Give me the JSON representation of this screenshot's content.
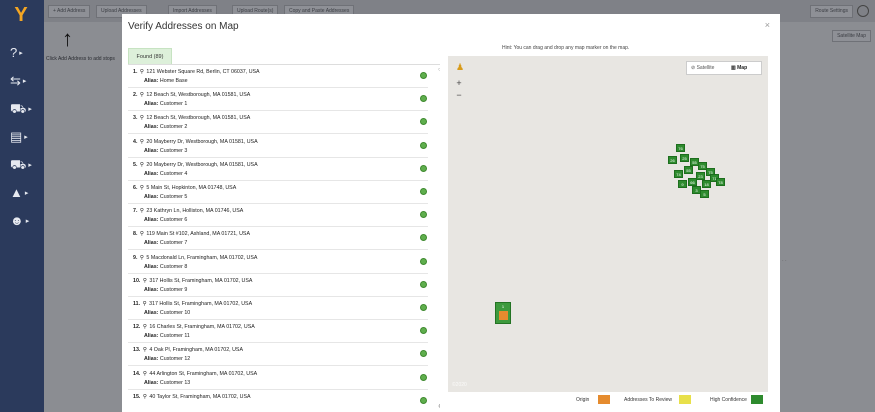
{
  "leftnav": {
    "logo": "Y",
    "items": [
      {
        "icon": "help-circle-icon",
        "glyph": "?"
      },
      {
        "icon": "route-icon",
        "glyph": "⇆"
      },
      {
        "icon": "cart-icon",
        "glyph": "⛟"
      },
      {
        "icon": "orders-icon",
        "glyph": "▤"
      },
      {
        "icon": "truck-icon",
        "glyph": "⛟"
      },
      {
        "icon": "analytics-icon",
        "glyph": "▲"
      },
      {
        "icon": "team-icon",
        "glyph": "☻"
      }
    ]
  },
  "topbar": {
    "buttons": [
      "+ Add Address",
      "Upload Addresses",
      "Import Addresses",
      "Upload Route(s)",
      "Copy and Paste Addresses"
    ],
    "route_settings": "Route Settings"
  },
  "background": {
    "hint": "Click Add Address to add stops",
    "sat_map": "Satellite  Map"
  },
  "modal": {
    "title": "Verify Addresses on Map",
    "close": "×",
    "found_tab": "Found (89)",
    "map_hint": "Hint: You can drag and drop any map marker on the map.",
    "addresses": [
      {
        "num": "1.",
        "address": "121 Webster Square Rd, Berlin, CT 06037, USA",
        "alias_label": "Alias:",
        "alias": "Home Base"
      },
      {
        "num": "2.",
        "address": "12 Beach St, Westborough, MA 01581, USA",
        "alias_label": "Alias:",
        "alias": "Customer 1"
      },
      {
        "num": "3.",
        "address": "12 Beach St, Westborough, MA 01581, USA",
        "alias_label": "Alias:",
        "alias": "Customer 2"
      },
      {
        "num": "4.",
        "address": "20 Mayberry Dr, Westborough, MA 01581, USA",
        "alias_label": "Alias:",
        "alias": "Customer 3"
      },
      {
        "num": "5.",
        "address": "20 Mayberry Dr, Westborough, MA 01581, USA",
        "alias_label": "Alias:",
        "alias": "Customer 4"
      },
      {
        "num": "6.",
        "address": "5 Main St, Hopkinton, MA 01748, USA",
        "alias_label": "Alias:",
        "alias": "Customer 5"
      },
      {
        "num": "7.",
        "address": "23 Kathryn Ln, Holliston, MA 01746, USA",
        "alias_label": "Alias:",
        "alias": "Customer 6"
      },
      {
        "num": "8.",
        "address": "119 Main St #102, Ashland, MA 01721, USA",
        "alias_label": "Alias:",
        "alias": "Customer 7"
      },
      {
        "num": "9.",
        "address": "5 Macdonald Ln, Framingham, MA 01702, USA",
        "alias_label": "Alias:",
        "alias": "Customer 8"
      },
      {
        "num": "10.",
        "address": "317 Hollis St, Framingham, MA 01702, USA",
        "alias_label": "Alias:",
        "alias": "Customer 9"
      },
      {
        "num": "11.",
        "address": "317 Hollis St, Framingham, MA 01702, USA",
        "alias_label": "Alias:",
        "alias": "Customer 10"
      },
      {
        "num": "12.",
        "address": "16 Charles St, Framingham, MA 01702, USA",
        "alias_label": "Alias:",
        "alias": "Customer 11"
      },
      {
        "num": "13.",
        "address": "4 Oak Pl, Framingham, MA 01702, USA",
        "alias_label": "Alias:",
        "alias": "Customer 12"
      },
      {
        "num": "14.",
        "address": "44 Arlington St, Framingham, MA 01702, USA",
        "alias_label": "Alias:",
        "alias": "Customer 13"
      },
      {
        "num": "15.",
        "address": "40 Taylor St, Framingham, MA 01702, USA",
        "alias_label": "",
        "alias": ""
      }
    ],
    "map": {
      "satellite_label": "Satellite",
      "map_label": "Map",
      "zoom_in": "+",
      "zoom_out": "−",
      "scale": "©2020",
      "origin_label": "1",
      "cluster_labels": [
        "76",
        "26",
        "25",
        "55",
        "75",
        "55",
        "75",
        "71",
        "23",
        "74",
        "78",
        "18",
        "66",
        "9",
        "3",
        "5"
      ]
    },
    "legend": {
      "origin": "Origin",
      "review": "Addresses To Review",
      "high": "High Confidence",
      "colors": {
        "origin": "#e58b2e",
        "review": "#e8e04a",
        "high": "#2e8b2e"
      }
    }
  }
}
